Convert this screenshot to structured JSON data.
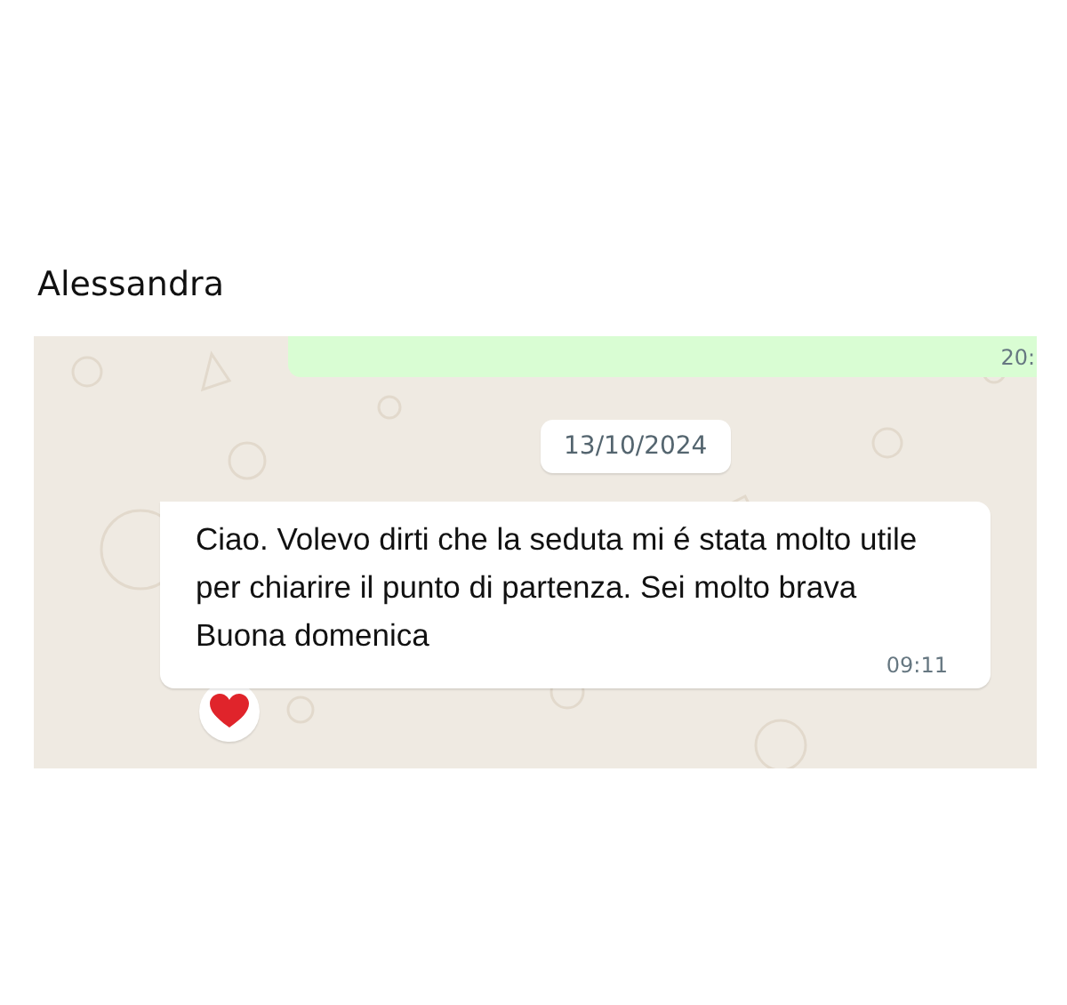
{
  "chat": {
    "contact_name": "Alessandra"
  },
  "messages": [
    {
      "kind": "outgoing",
      "time": "20:"
    },
    {
      "kind": "date",
      "text": "13/10/2024"
    },
    {
      "kind": "incoming",
      "lines": [
        "Ciao. Volevo dirti che la seduta mi é stata molto utile per chiarire il punto di partenza. Sei molto brava",
        "Buona domenica"
      ],
      "time": "09:11",
      "reacted": true
    }
  ]
}
